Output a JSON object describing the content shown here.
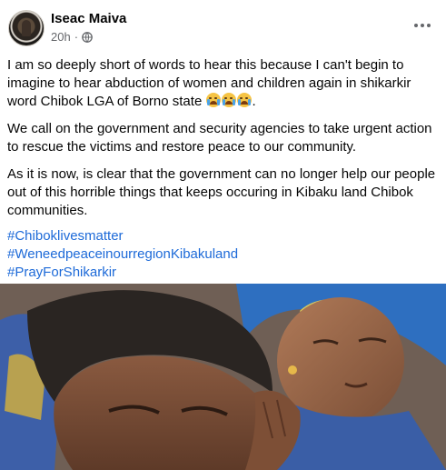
{
  "post": {
    "author": "Iseac Maiva",
    "time": "20h",
    "separator": "·",
    "paragraphs": [
      "I am so deeply short of words to hear this because I can't begin to imagine to hear abduction of women and children again in shikarkir word Chibok LGA of Borno state",
      "We call on the government and security agencies to take urgent action to rescue the victims and restore peace to our community.",
      "As it is now, is clear that the government can no longer help our people out of this horrible things that keeps occuring in Kibaku land Chibok communities."
    ],
    "paragraph1_suffix": ".",
    "hashtags": [
      "#Chiboklivesmatter",
      "#WeneedpeaceinourregionKibakuland",
      "#PrayForShikarkir"
    ],
    "icons": {
      "globe": "globe-icon",
      "more": "more-options-icon",
      "emoji": "crying-face-emoji"
    },
    "colors": {
      "hashtag": "#1d6ad8",
      "meta": "#65676b",
      "text": "#050505"
    }
  }
}
